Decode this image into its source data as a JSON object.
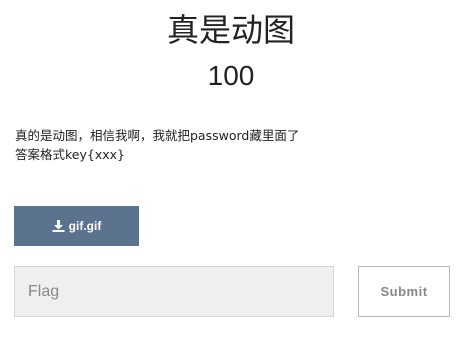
{
  "challenge": {
    "title": "真是动图",
    "points": "100",
    "description_lines": [
      "真的是动图，相信我啊，我就把password藏里面了",
      "答案格式key{xxx}"
    ]
  },
  "file": {
    "label": "gif.gif",
    "icon": "download-icon"
  },
  "flag_form": {
    "placeholder": "Flag",
    "value": "",
    "submit_label": "Submit"
  },
  "colors": {
    "download_button_bg": "#5c7390",
    "download_button_text": "#ffffff",
    "input_bg": "#efefef",
    "submit_text": "#888888"
  }
}
